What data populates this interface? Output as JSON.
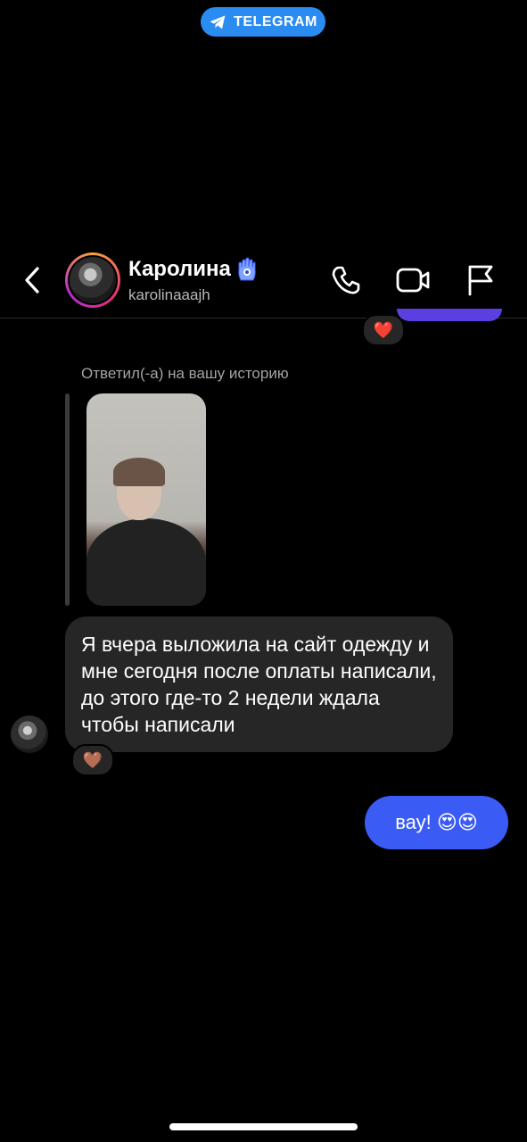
{
  "banner": {
    "label": "TELEGRAM",
    "color": "#2a8cf0"
  },
  "header": {
    "contact_name": "Каролина",
    "contact_handle": "karolinaaajh",
    "back_icon": "chevron-left-icon",
    "call_icon": "phone-icon",
    "video_icon": "video-camera-icon",
    "report_icon": "flag-icon",
    "name_emoji": "hamsa-icon"
  },
  "chat": {
    "previous_reaction": "❤️",
    "reply_note": "Ответил(-а) на вашу историю",
    "incoming_message": "Я вчера выложила на сайт одежду и мне сегодня после оплаты написали, до этого где-то 2 недели ждала чтобы написали",
    "incoming_reaction": "🤎",
    "outgoing_message": "вау! 😍😍"
  },
  "colors": {
    "background": "#000000",
    "incoming_bubble": "#262626",
    "outgoing_bubble": "#3b5bf5"
  }
}
